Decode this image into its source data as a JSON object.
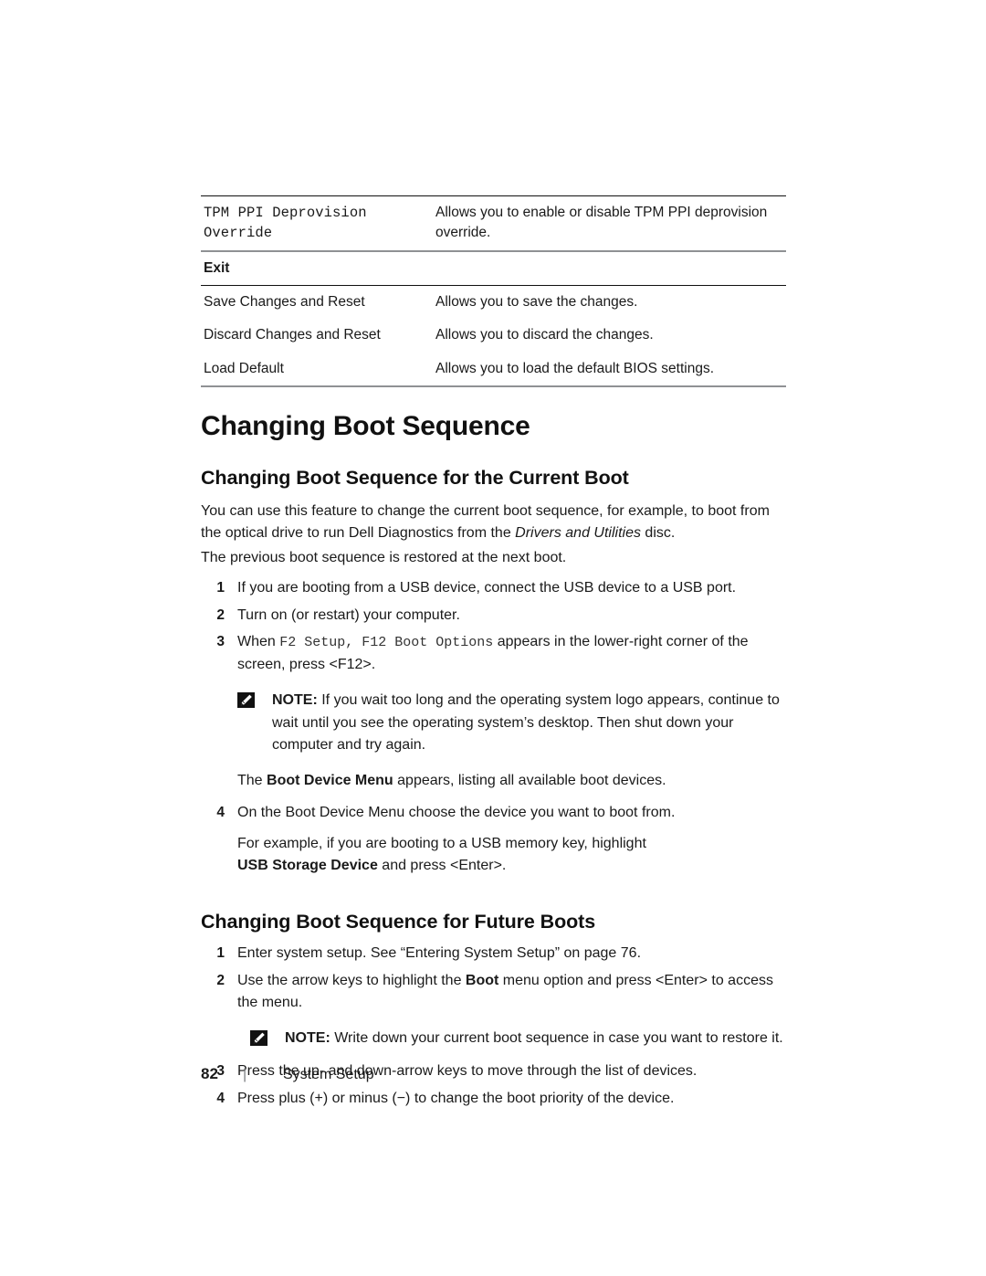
{
  "document": {
    "page_number": "82",
    "footer_separator": "|",
    "footer_section": "System Setup"
  },
  "table": {
    "rows": [
      {
        "type": "entry",
        "name": "TPM PPI Deprovision Override",
        "description": "Allows you to enable or disable TPM PPI deprovision override."
      },
      {
        "type": "section",
        "name": "Exit",
        "description": ""
      },
      {
        "type": "entry",
        "name": "Save Changes and Reset",
        "description": "Allows you to save the changes."
      },
      {
        "type": "entry",
        "name": "Discard Changes and Reset",
        "description": "Allows you to discard the changes."
      },
      {
        "type": "entry",
        "name": "Load Default",
        "description": "Allows you to load the default BIOS settings."
      }
    ]
  },
  "headings": {
    "h1": "Changing Boot Sequence",
    "h2_current": "Changing Boot Sequence for the Current Boot",
    "h2_future": "Changing Boot Sequence for Future Boots"
  },
  "current_boot": {
    "intro_part1": "You can use this feature to change the current boot sequence, for example, to boot from the optical drive to run Dell Diagnostics from the ",
    "intro_italic": "Drivers and Utilities",
    "intro_part2": " disc.",
    "intro_line2": "The previous boot sequence is restored at the next boot.",
    "steps": [
      {
        "num": "1",
        "text": "If you are booting from a USB device, connect the USB device to a USB port."
      },
      {
        "num": "2",
        "text": "Turn on (or restart) your computer."
      },
      {
        "num": "3",
        "prefix": "When ",
        "code": "F2 Setup, F12 Boot Options",
        "suffix": " appears in the lower-right corner of the screen, press <F12>."
      },
      {
        "num": "4",
        "text": "On the Boot Device Menu choose the device you want to boot from."
      }
    ],
    "note": {
      "icon": "note-pencil-icon",
      "label": "NOTE:",
      "text": " If you wait too long and the operating system logo appears, continue to wait until you see the operating system’s desktop. Then shut down your computer and try again."
    },
    "after_note_prefix": "The ",
    "after_note_bold": "Boot Device Menu",
    "after_note_suffix": " appears, listing all available boot devices.",
    "example_line1": "For example, if you are booting to a USB memory key, highlight",
    "example_bold": "USB Storage Device",
    "example_suffix": " and press <Enter>."
  },
  "future_boots": {
    "steps": [
      {
        "num": "1",
        "text": "Enter system setup. See “Entering System Setup” on page 76."
      },
      {
        "num": "2",
        "prefix": "Use the arrow keys to highlight the ",
        "bold": "Boot",
        "suffix": " menu option and press <Enter> to access the menu."
      },
      {
        "num": "3",
        "text": "Press the up- and down-arrow keys to move through the list of devices."
      },
      {
        "num": "4",
        "text": "Press plus (+) or minus (−) to change the boot priority of the device."
      }
    ],
    "note": {
      "icon": "note-pencil-icon",
      "label": "NOTE:",
      "text": " Write down your current boot sequence in case you want to restore it."
    }
  },
  "colors": {
    "text": "#1a1a1a",
    "rule_dark": "#111111",
    "rule_light": "#8f9194",
    "icon_fill": "#111111"
  }
}
